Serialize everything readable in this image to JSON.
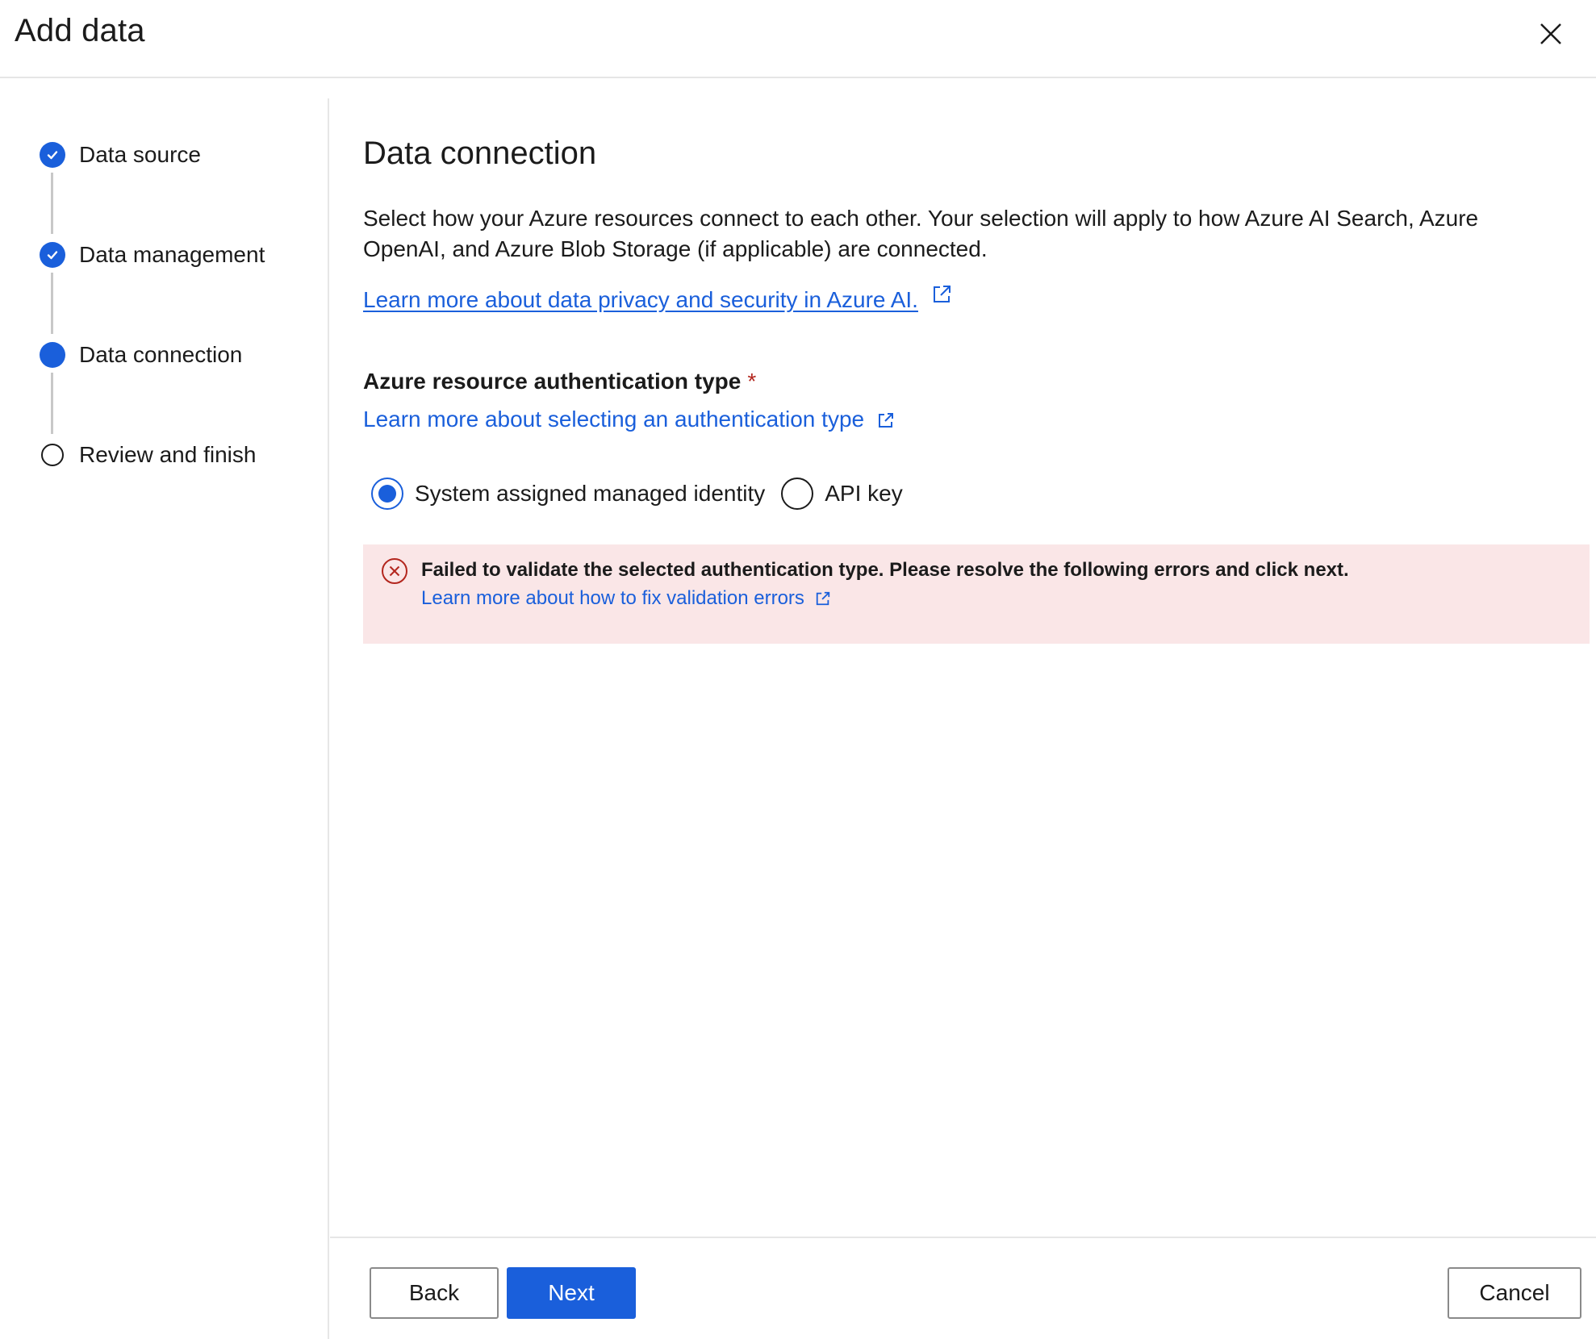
{
  "dialog": {
    "title": "Add data",
    "close_icon": "close-icon"
  },
  "steps": [
    {
      "label": "Data source",
      "state": "completed"
    },
    {
      "label": "Data management",
      "state": "completed"
    },
    {
      "label": "Data connection",
      "state": "current"
    },
    {
      "label": "Review and finish",
      "state": "pending"
    }
  ],
  "main": {
    "heading": "Data connection",
    "description": "Select how your Azure resources connect to each other. Your selection will apply to how Azure AI Search, Azure OpenAI, and Azure Blob Storage (if applicable) are connected.",
    "privacy_link": "Learn more about data privacy and security in Azure AI."
  },
  "auth": {
    "label": "Azure resource authentication type",
    "required_marker": "*",
    "learn_link": "Learn more about selecting an authentication type",
    "options": [
      {
        "label": "System assigned managed identity",
        "selected": true
      },
      {
        "label": "API key",
        "selected": false
      }
    ]
  },
  "error": {
    "title": "Failed to validate the selected authentication type. Please resolve the following errors and click next.",
    "link": "Learn more about how to fix validation errors"
  },
  "footer": {
    "back_label": "Back",
    "next_label": "Next",
    "cancel_label": "Cancel"
  },
  "colors": {
    "accent": "#1a5fdb",
    "error_background": "#fae6e7",
    "error_icon": "#b3261e"
  }
}
